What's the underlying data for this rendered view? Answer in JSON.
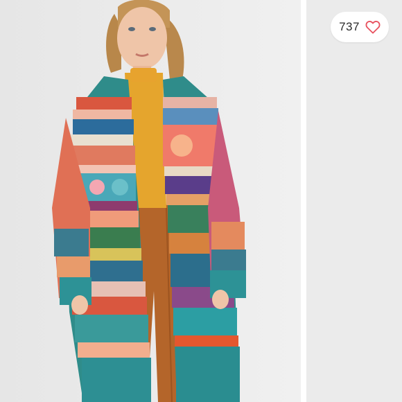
{
  "listing": {
    "like_count": "737",
    "like_icon": "heart-outline-icon",
    "like_color": "#e8525f"
  },
  "colors": {
    "background": "#ececec",
    "divider": "#ffffff"
  }
}
